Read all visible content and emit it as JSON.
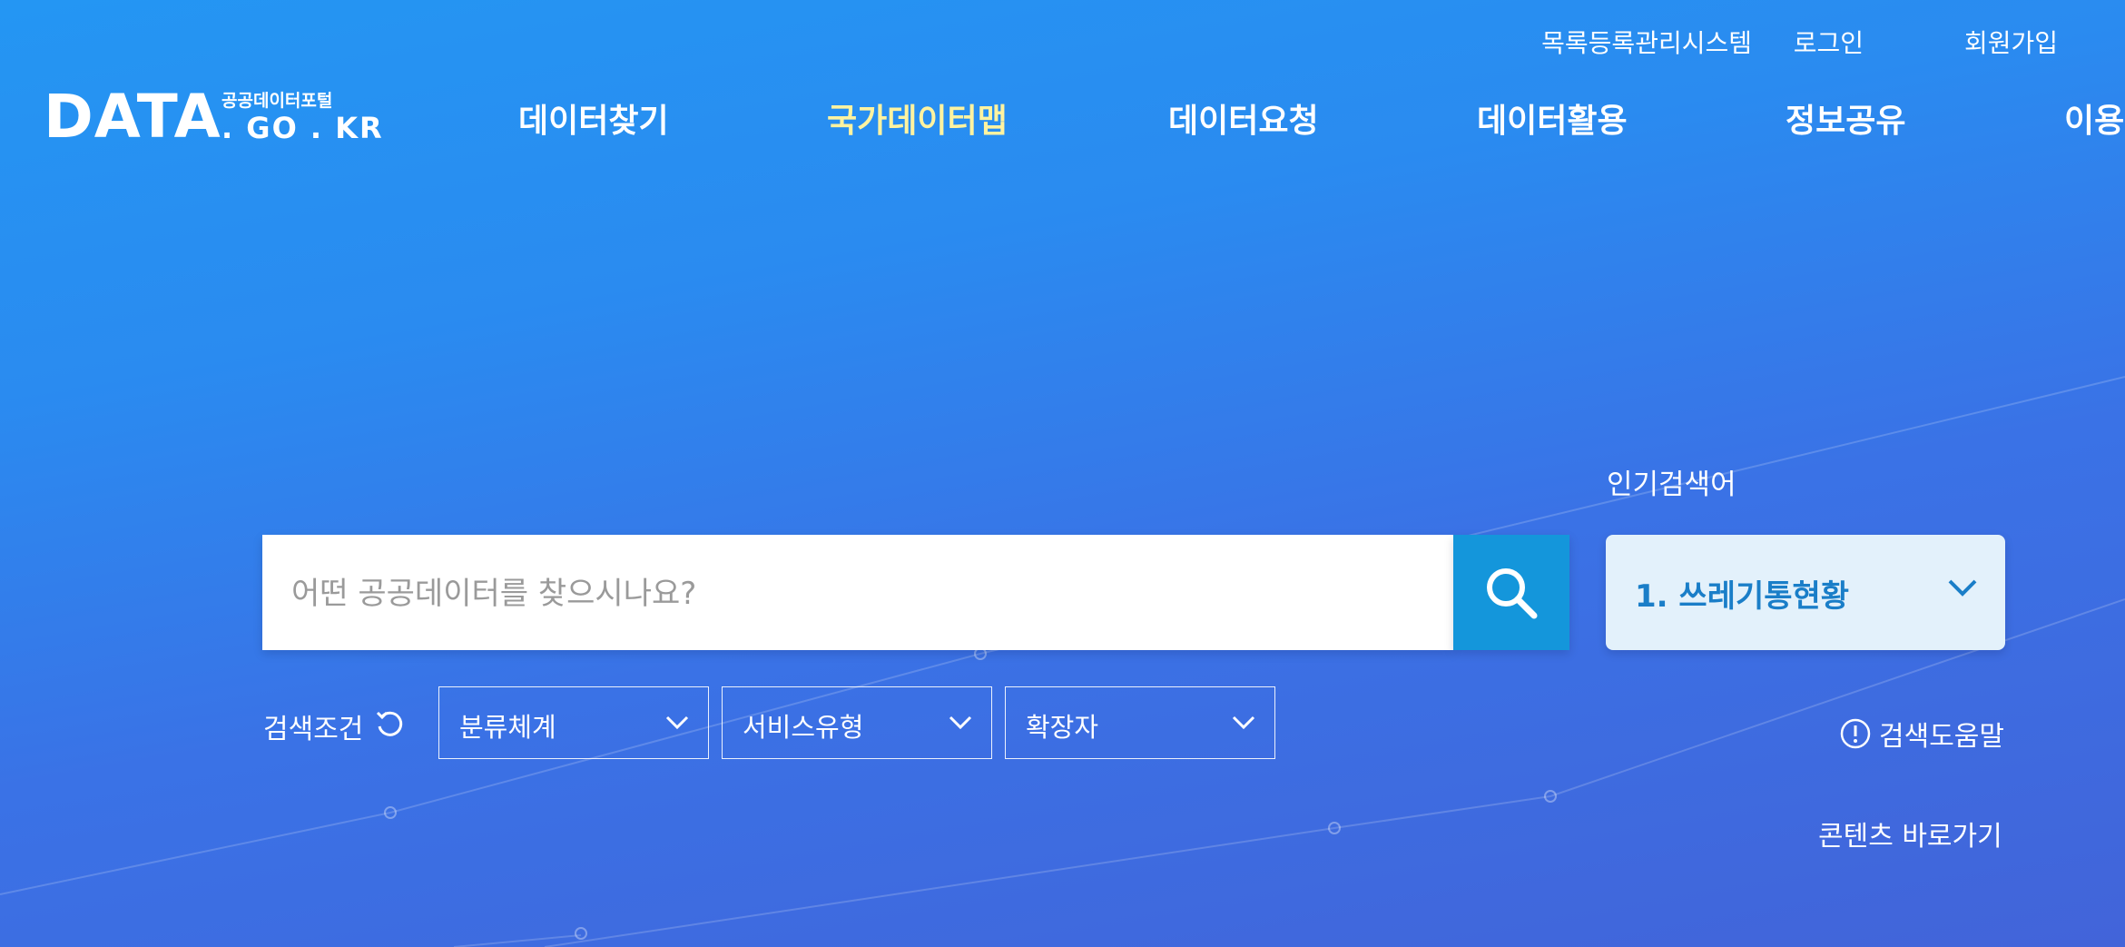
{
  "util_links": {
    "catalog": "목록등록관리시스템",
    "login": "로그인",
    "signup": "회원가입"
  },
  "logo": {
    "main": "DATA",
    "sub_korean": "공공데이터포털",
    "sub_domain": ". GO . KR"
  },
  "nav": {
    "items": [
      "데이터찾기",
      "국가데이터맵",
      "데이터요청",
      "데이터활용",
      "정보공유",
      "이용"
    ],
    "active_index": 1,
    "active_color": "#fff3a0"
  },
  "search": {
    "placeholder": "어떤 공공데이터를 찾으시나요?",
    "value": "",
    "button_icon": "search-icon"
  },
  "popular": {
    "label": "인기검색어",
    "current": "1. 쓰레기통현황"
  },
  "conditions": {
    "label": "검색조건",
    "filters": [
      "분류체계",
      "서비스유형",
      "확장자"
    ]
  },
  "help_text": "검색도움말",
  "shortcut_text": "콘텐츠 바로가기",
  "colors": {
    "search_button": "#1496db",
    "popular_text": "#1a7ec8",
    "popular_bg": "#e3f1fb"
  }
}
